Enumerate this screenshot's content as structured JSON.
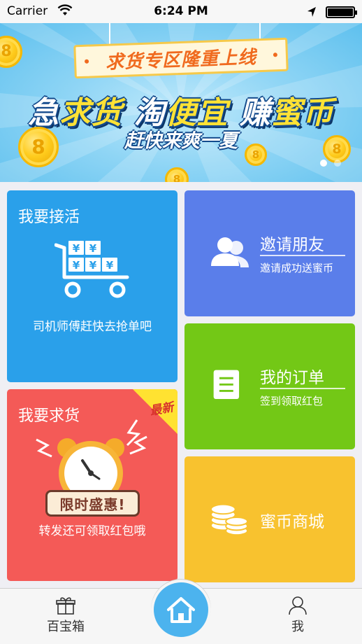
{
  "status_bar": {
    "carrier": "Carrier",
    "time": "6:24 PM"
  },
  "banner": {
    "tag": "求货专区隆重上线",
    "headline_part1": "急",
    "headline_part2": "求货",
    "headline_part3": " 淘",
    "headline_part4": "便宜",
    "headline_part5": " 赚",
    "headline_part6": "蜜币",
    "sub": "赶快来爽一夏",
    "pager": {
      "count": 2,
      "active_index": 0
    }
  },
  "tiles": {
    "take_job": {
      "title": "我要接活",
      "caption": "司机师傅赶快去抢单吧"
    },
    "request_goods": {
      "title": "我要求货",
      "badge": "最新",
      "promo": "限时盛惠!",
      "caption": "转发还可领取红包哦"
    },
    "invite": {
      "title": "邀请朋友",
      "subtitle": "邀请成功送蜜币"
    },
    "orders": {
      "title": "我的订单",
      "subtitle": "签到领取红包"
    },
    "mall": {
      "title": "蜜币商城"
    }
  },
  "tabbar": {
    "left_label": "百宝箱",
    "right_label": "我"
  },
  "colors": {
    "take_job": "#2aa0ea",
    "request_goods": "#f45a57",
    "invite": "#5a7eea",
    "orders": "#73c816",
    "mall": "#f8c22f",
    "home_button": "#4cb3ee"
  },
  "icons": {
    "cart": "cart-with-yen-boxes-icon",
    "clock": "alarm-clock-icon",
    "invite": "people-icon",
    "orders": "document-icon",
    "mall": "coin-stack-icon",
    "home": "house-icon",
    "treasure": "gift-box-icon",
    "me": "person-icon"
  }
}
